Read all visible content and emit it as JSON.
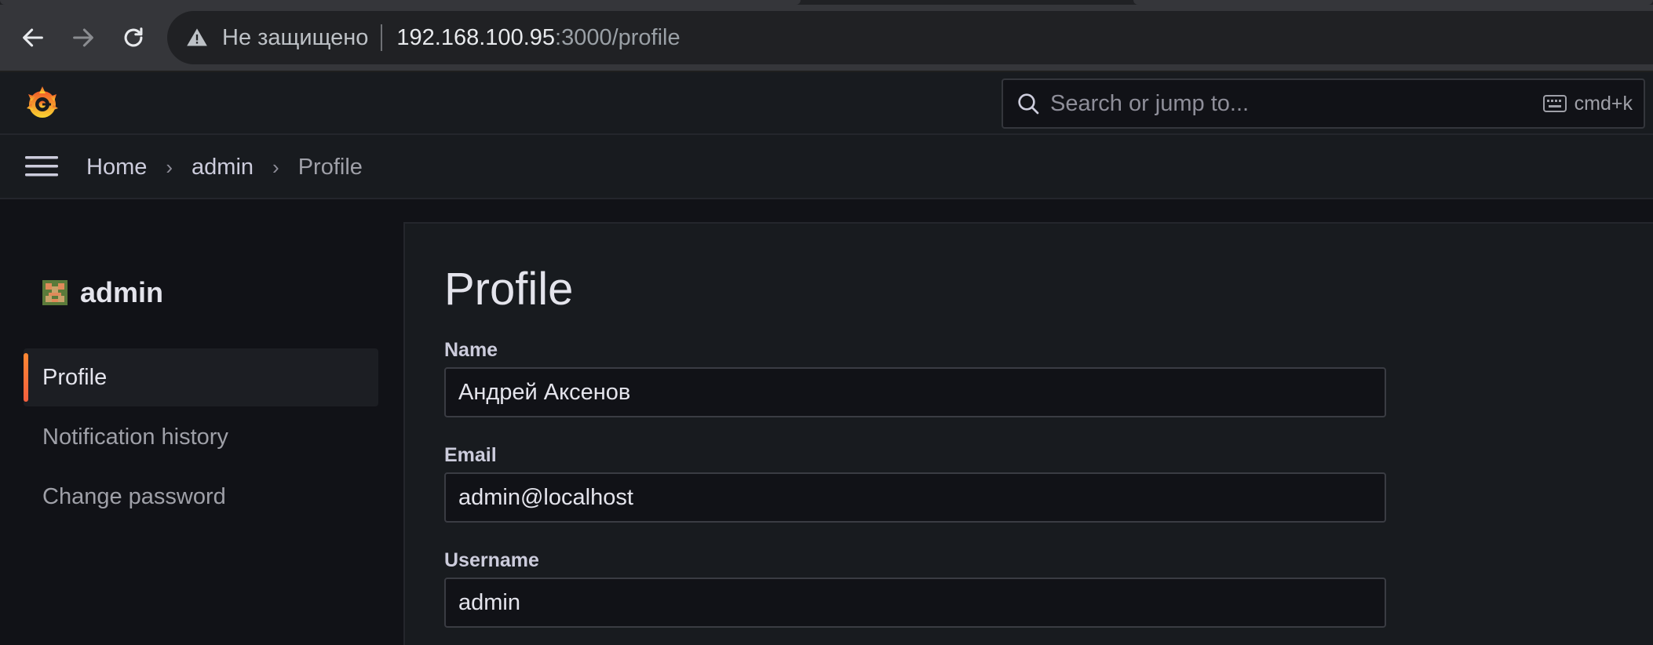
{
  "browser": {
    "security_label": "Не защищено",
    "url_host": "192.168.100.95",
    "url_path": ":3000/profile"
  },
  "search": {
    "placeholder": "Search or jump to...",
    "shortcut": "cmd+k"
  },
  "breadcrumb": [
    "Home",
    "admin",
    "Profile"
  ],
  "sidebar": {
    "user": "admin",
    "items": [
      {
        "label": "Profile",
        "active": true
      },
      {
        "label": "Notification history",
        "active": false
      },
      {
        "label": "Change password",
        "active": false
      }
    ]
  },
  "main": {
    "title": "Profile",
    "fields": {
      "name": {
        "label": "Name",
        "value": "Андрей Аксенов"
      },
      "email": {
        "label": "Email",
        "value": "admin@localhost"
      },
      "username": {
        "label": "Username",
        "value": "admin"
      }
    }
  },
  "colors": {
    "accent": "#f55f3e",
    "logo": "#f46800",
    "background": "#111217",
    "panel": "#181b1f"
  },
  "icons": [
    "back-icon",
    "forward-icon",
    "reload-icon",
    "warning-icon",
    "grafana-logo",
    "search-icon",
    "keyboard-icon",
    "menu-icon",
    "avatar"
  ]
}
